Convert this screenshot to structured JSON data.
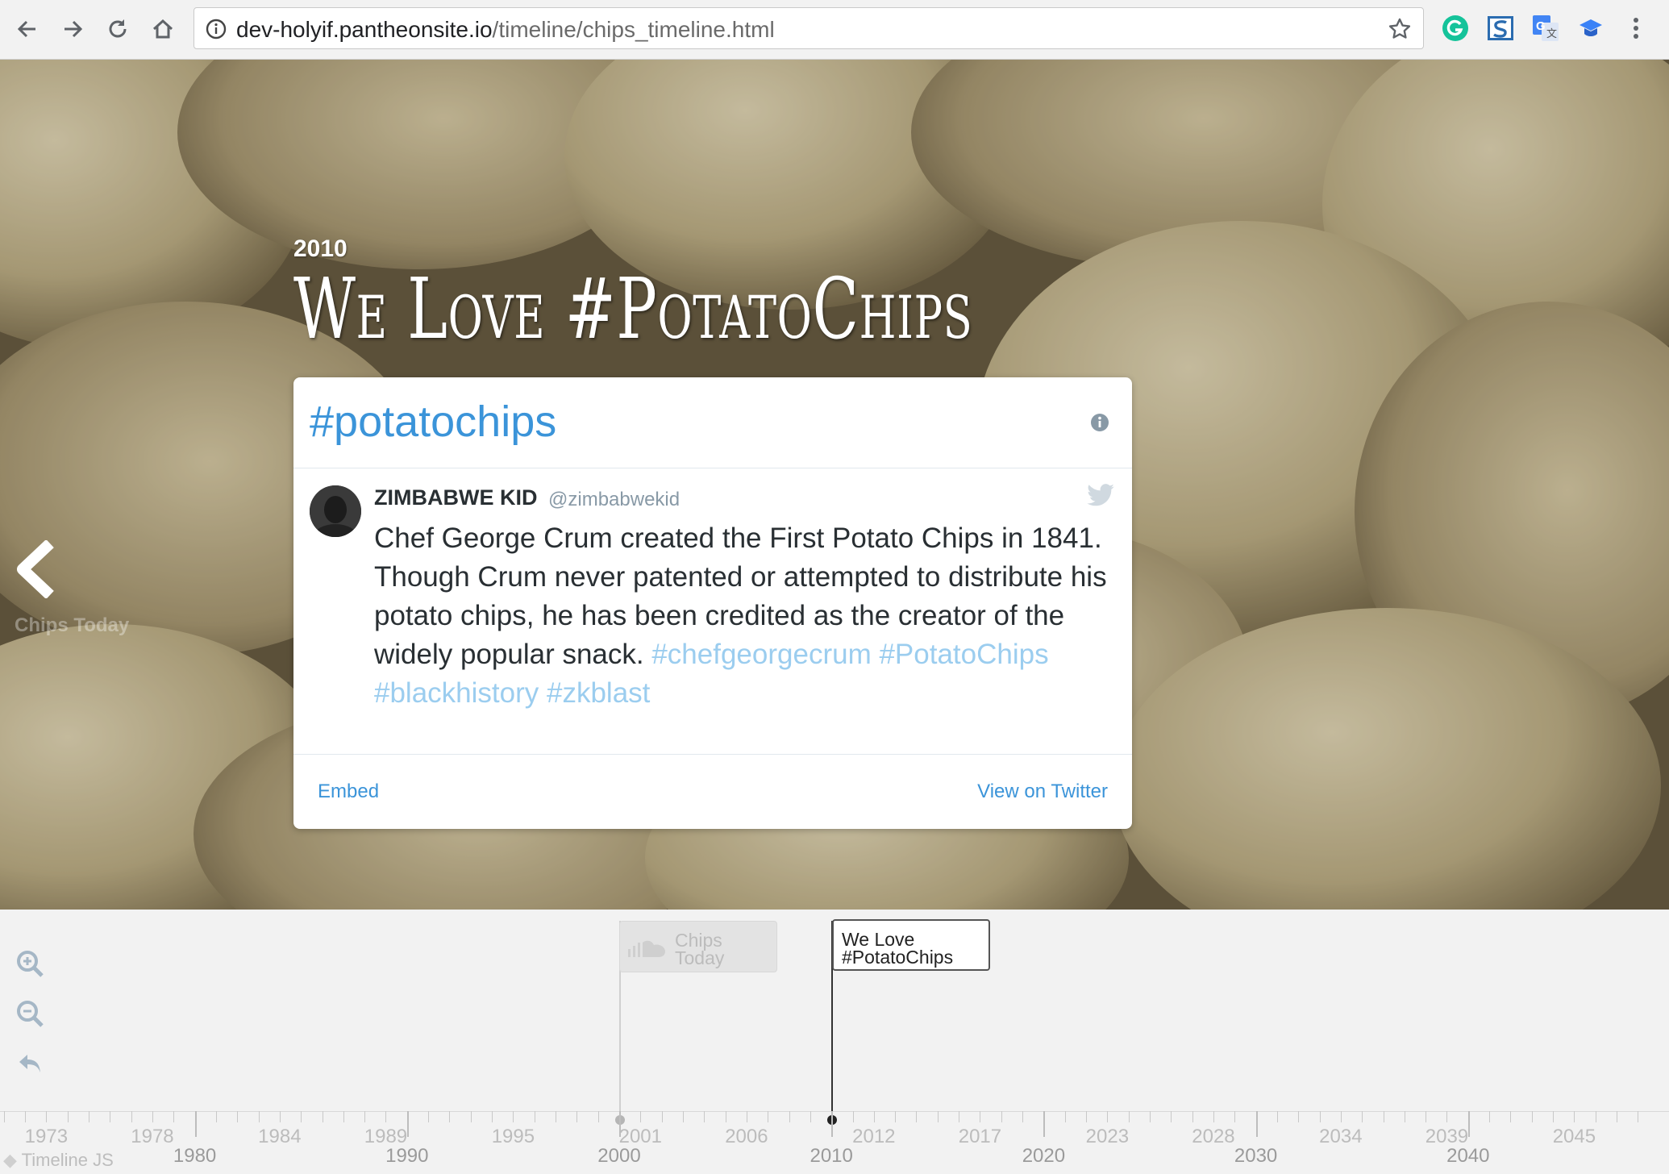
{
  "browser": {
    "url_host": "dev-holyif.pantheonsite.io",
    "url_path": "/timeline/chips_timeline.html",
    "extensions": [
      "grammarly-icon",
      "s-extension-icon",
      "translate-icon",
      "cap-extension-icon"
    ]
  },
  "slide": {
    "date": "2010",
    "title": "We Love #PotatoChips",
    "prev_label": "Chips Today"
  },
  "tweet": {
    "hashtag_header": "#potatochips",
    "author_name": "ZIMBABWE KID",
    "author_handle": "@zimbabwekid",
    "text_part1": "Chef George Crum created the First Potato Chips in 1841.",
    "text_part2": "Though Crum never patented or  attempted to  distribute his potato chips, he has been credited as the  creator of the widely popular snack. ",
    "tags": "#chefgeorgecrum #PotatoChips #blackhistory #zkblast",
    "embed_label": "Embed",
    "view_label": "View on Twitter"
  },
  "timeline": {
    "attribution": "Timeline JS",
    "markers": [
      {
        "label": "Chips Today",
        "active": false
      },
      {
        "label": "We Love #PotatoChips",
        "active": true
      }
    ],
    "minor_years": [
      "1973",
      "1978",
      "1984",
      "1989",
      "1995",
      "2001",
      "2006",
      "2012",
      "2017",
      "2023",
      "2028",
      "2034",
      "2039",
      "2045"
    ],
    "major_years": [
      "1980",
      "1990",
      "2000",
      "2010",
      "2020",
      "2030",
      "2040"
    ]
  },
  "colors": {
    "link": "#3b94d9",
    "hashtag_light": "#9bcdef",
    "card_bg": "#ffffff"
  }
}
